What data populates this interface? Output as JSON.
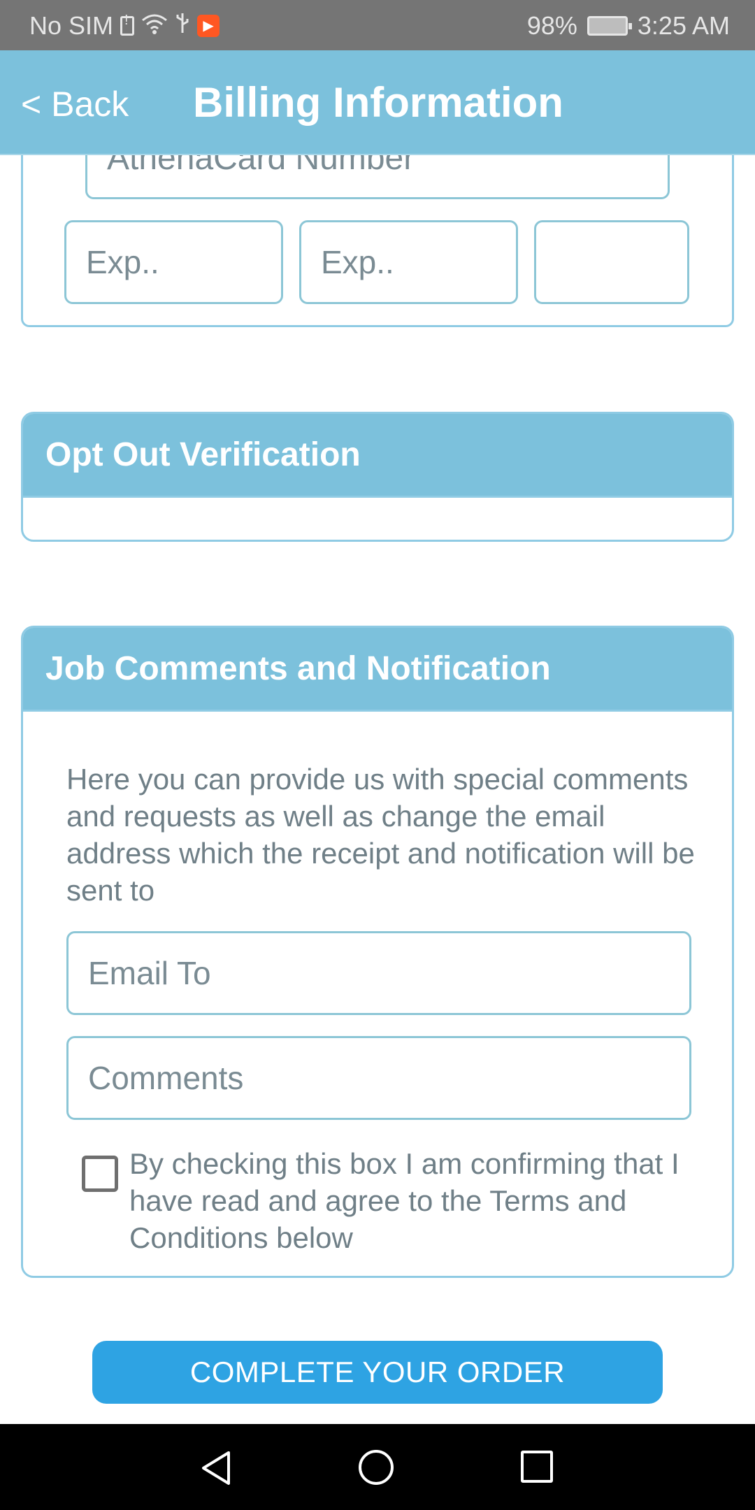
{
  "status_bar": {
    "carrier": "No SIM",
    "battery": "98%",
    "time": "3:25 AM"
  },
  "header": {
    "back_label": "< Back",
    "title": "Billing Information"
  },
  "card_fields": {
    "card_number_placeholder": "AthenaCard Number",
    "exp_month_placeholder": "Exp..",
    "exp_year_placeholder": "Exp..",
    "cvv_placeholder": ""
  },
  "opt_out": {
    "title": "Opt Out Verification"
  },
  "job_comments": {
    "title": "Job Comments and Notification",
    "description": "Here you can provide us with special comments and requests as well as change the email address which the receipt and notification will be sent to",
    "email_placeholder": "Email To",
    "comments_placeholder": "Comments",
    "terms_text": "By checking this box I am confirming that I have read and agree to the Terms and Conditions below"
  },
  "actions": {
    "complete_label": "COMPLETE YOUR ORDER"
  },
  "colors": {
    "header_bg": "#7cc1dc",
    "button_bg": "#2ea3e3",
    "border": "#8cc6d6"
  }
}
